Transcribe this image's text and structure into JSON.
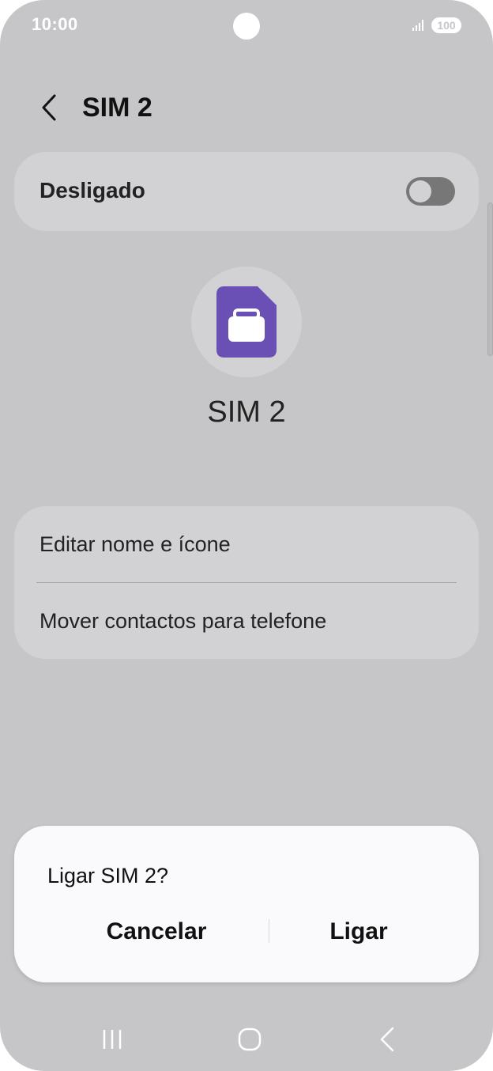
{
  "status_bar": {
    "time": "10:00",
    "battery": "100",
    "icons": [
      "camera-cutout",
      "signal-icon",
      "battery-icon"
    ]
  },
  "header": {
    "back_icon": "chevron-left-icon",
    "title": "SIM 2"
  },
  "toggle": {
    "label": "Desligado",
    "state": "off"
  },
  "sim": {
    "icon": "sim-card-briefcase-icon",
    "icon_color": "#6a4fb4",
    "name": "SIM 2"
  },
  "options": [
    {
      "label": "Editar nome e ícone"
    },
    {
      "label": "Mover contactos para telefone"
    }
  ],
  "dialog": {
    "title": "Ligar SIM 2?",
    "cancel_label": "Cancelar",
    "confirm_label": "Ligar"
  },
  "nav_bar": {
    "icons": [
      "recent-apps-icon",
      "home-icon",
      "back-icon"
    ]
  },
  "colors": {
    "scrim_background": "#c6c6c8",
    "card_background": "#d2d2d4",
    "dialog_background": "#fafafc",
    "accent_purple": "#6a4fb4"
  }
}
